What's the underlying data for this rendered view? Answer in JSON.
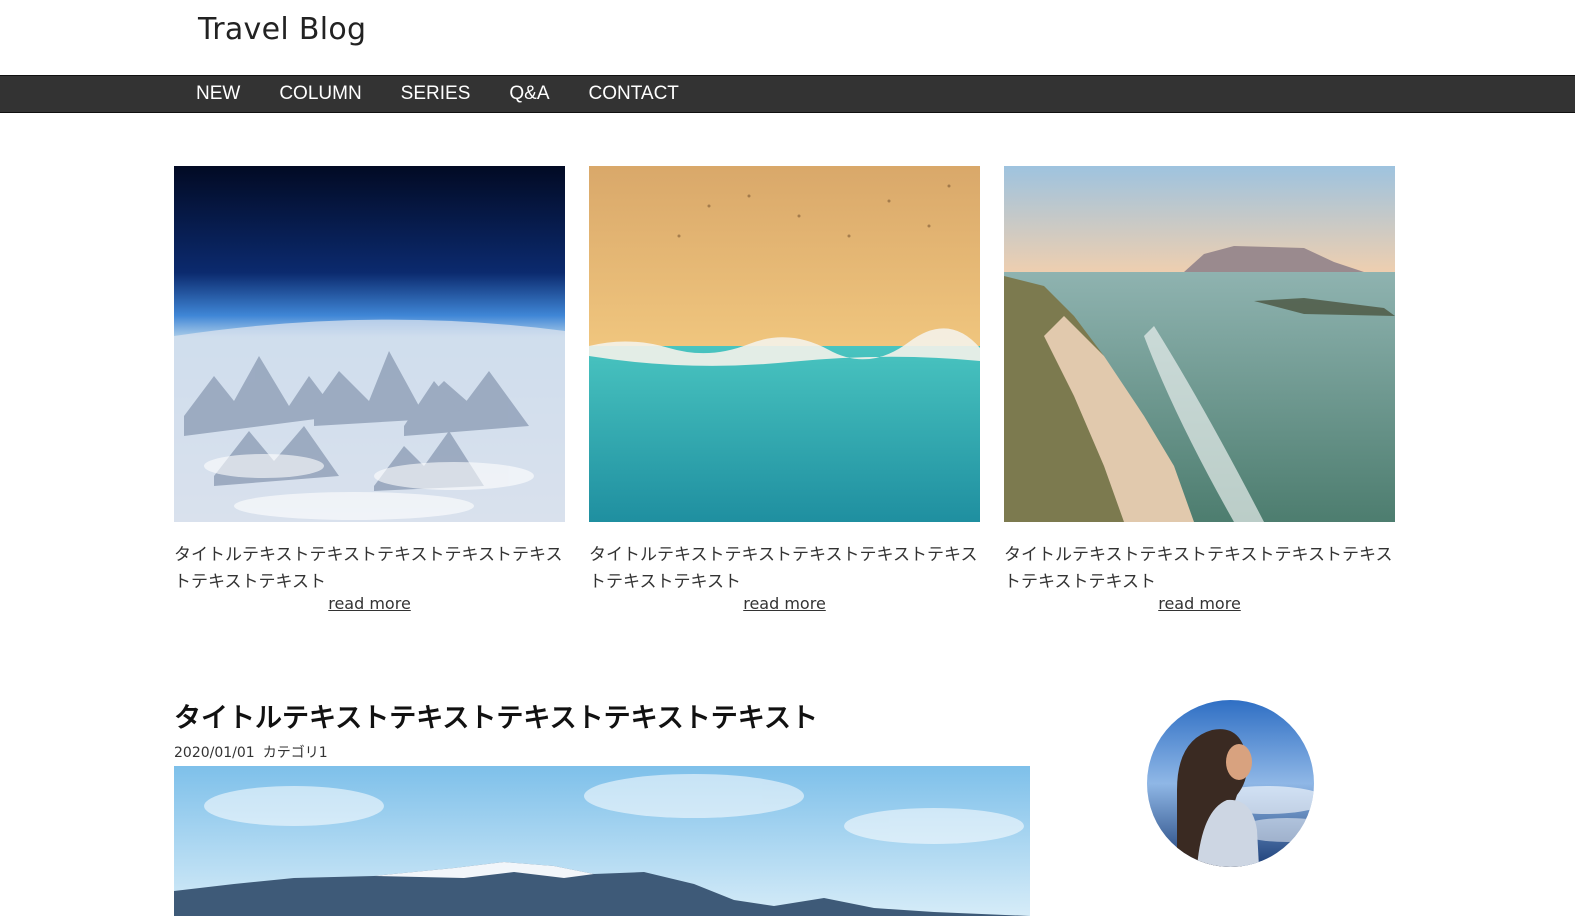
{
  "header": {
    "site_title": "Travel Blog"
  },
  "nav": {
    "items": [
      "NEW",
      "COLUMN",
      "SERIES",
      "Q&A",
      "CONTACT"
    ]
  },
  "cards": [
    {
      "title": "タイトルテキストテキストテキストテキストテキス トテキストテキスト",
      "read_more": "read more",
      "image": "earth-from-space-photo"
    },
    {
      "title": "タイトルテキストテキストテキストテキストテキス トテキストテキスト",
      "read_more": "read more",
      "image": "aerial-beach-photo"
    },
    {
      "title": "タイトルテキストテキストテキストテキストテキス トテキストテキスト",
      "read_more": "read more",
      "image": "coastal-town-beach-photo"
    }
  ],
  "post": {
    "title": "タイトルテキストテキストテキストテキストテキスト",
    "date": "2020/01/01",
    "category": "カテゴリ1",
    "image": "snowy-mountain-range-photo"
  },
  "sidebar": {
    "avatar": "profile-woman-photo"
  },
  "colors": {
    "nav_bg": "#333333",
    "nav_text": "#ffffff",
    "page_bg": "#ffffff"
  }
}
